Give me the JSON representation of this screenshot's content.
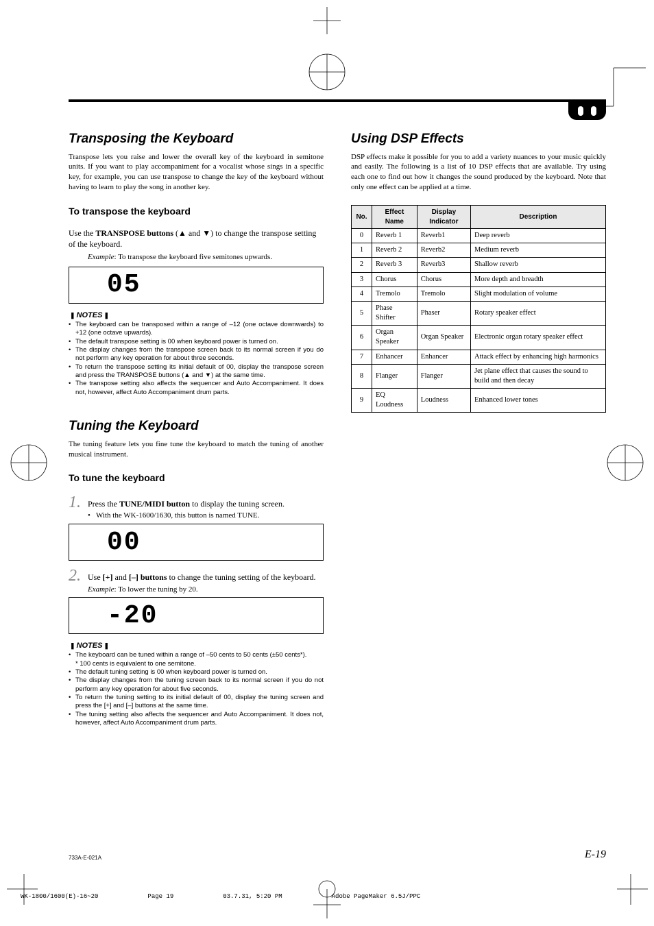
{
  "transposing": {
    "title": "Transposing the Keyboard",
    "intro": "Transpose lets you raise and lower the overall key of the keyboard in semitone units. If you want to play accompaniment for a vocalist whose sings in a specific key, for example, you can use transpose to change the key of the keyboard without having to learn to play the song in another key.",
    "sub": "To transpose the keyboard",
    "instr1": "Use the ",
    "instr2": "TRANSPOSE buttons",
    "instr3": " (▲ and ▼) to change the transpose setting of the keyboard.",
    "ex_label": "Example",
    "ex_text": ": To transpose the keyboard five semitones upwards.",
    "lcd": "05",
    "notes_h": "NOTES",
    "notes": [
      "The keyboard can be transposed within a range of –12 (one octave downwards) to +12 (one octave upwards).",
      "The default transpose setting is 00 when keyboard power is turned on.",
      "The display changes from the transpose screen back to its normal screen if you do not perform any key operation for about three seconds.",
      "To return the transpose setting its initial default of 00, display the transpose screen and press the TRANSPOSE buttons (▲ and ▼) at the same time.",
      "The transpose setting also affects the sequencer and Auto Accompaniment. It does not, however, affect Auto Accompaniment drum parts."
    ]
  },
  "tuning": {
    "title": "Tuning the Keyboard",
    "intro": "The tuning feature lets you fine tune the keyboard to match the tuning of another musical instrument.",
    "sub": "To tune the keyboard",
    "step1a": "Press the ",
    "step1b": "TUNE/MIDI button",
    "step1c": " to display the tuning screen.",
    "step1_sub": "With the WK-1600/1630, this button is named TUNE.",
    "lcd1": "00",
    "step2a": "Use ",
    "step2b": "[+]",
    "step2c": " and ",
    "step2d": "[–] buttons",
    "step2e": " to change the tuning setting of the keyboard.",
    "step2_ex_label": "Example",
    "step2_ex": ": To lower the tuning by 20.",
    "lcd2": "-20",
    "notes_h": "NOTES",
    "notes": [
      "The keyboard can be tuned within a range of –50 cents to 50 cents (±50 cents*).",
      "* 100 cents is equivalent to one semitone.",
      "The default tuning setting is 00 when keyboard power is turned on.",
      "The display changes from the tuning screen back to its normal screen if you do not perform any key operation for about five seconds.",
      "To return the tuning setting to its initial default of 00, display the tuning screen and press the [+] and [–] buttons at the same time.",
      "The tuning setting also affects the sequencer and Auto Accompaniment. It does not, however, affect Auto Accompaniment drum parts."
    ]
  },
  "dsp": {
    "title": "Using DSP Effects",
    "intro": "DSP effects make it possible for you to add a variety nuances to your music quickly and easily. The following is a list of 10 DSP effects that are available. Try using each one to find out how it changes the sound produced by the keyboard. Note that only one effect can be applied at a time.",
    "headers": [
      "No.",
      "Effect Name",
      "Display Indicator",
      "Description"
    ],
    "rows": [
      [
        "0",
        "Reverb 1",
        "Reverb1",
        "Deep reverb"
      ],
      [
        "1",
        "Reverb 2",
        "Reverb2",
        "Medium reverb"
      ],
      [
        "2",
        "Reverb 3",
        "Reverb3",
        "Shallow reverb"
      ],
      [
        "3",
        "Chorus",
        "Chorus",
        "More depth and breadth"
      ],
      [
        "4",
        "Tremolo",
        "Tremolo",
        "Slight modulation of volume"
      ],
      [
        "5",
        "Phase Shifter",
        "Phaser",
        "Rotary speaker effect"
      ],
      [
        "6",
        "Organ Speaker",
        "Organ Speaker",
        "Electronic organ rotary speaker effect"
      ],
      [
        "7",
        "Enhancer",
        "Enhancer",
        "Attack effect by enhancing high harmonics"
      ],
      [
        "8",
        "Flanger",
        "Flanger",
        "Jet plane effect that causes the sound to build and then decay"
      ],
      [
        "9",
        "EQ Loudness",
        "Loudness",
        "Enhanced lower tones"
      ]
    ]
  },
  "footer": {
    "id": "733A-E-021A",
    "page": "E-19"
  },
  "crop": {
    "file": "WK-1800/1600(E)-16~20",
    "page": "Page 19",
    "date": "03.7.31, 5:20 PM",
    "app": "Adobe PageMaker 6.5J/PPC"
  }
}
